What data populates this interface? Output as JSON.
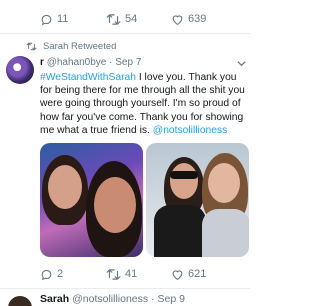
{
  "top_actions": {
    "reply_count": "11",
    "retweet_count": "54",
    "like_count": "639"
  },
  "retweet_label": "Sarah Retweeted",
  "tweet": {
    "display_name": "r",
    "handle": "@hahan0bye",
    "separator": "·",
    "date": "Sep 7",
    "hashtag": "#WeStandWithSarah",
    "body": " I love you. Thank you for being there for me through all the shit you were going through yourself. I'm so proud of how far you've come. Thank you for showing me what a true friend is. ",
    "mention": "@notsolillioness",
    "reply_count": "2",
    "retweet_count": "41",
    "like_count": "621"
  },
  "next_tweet": {
    "display_name": "Sarah",
    "handle": "@notsolillioness",
    "separator": "·",
    "date": "Sep 9"
  },
  "colors": {
    "accent": "#1da1f2",
    "muted": "#657786",
    "text": "#14171a",
    "divider": "#e6ecf0"
  }
}
